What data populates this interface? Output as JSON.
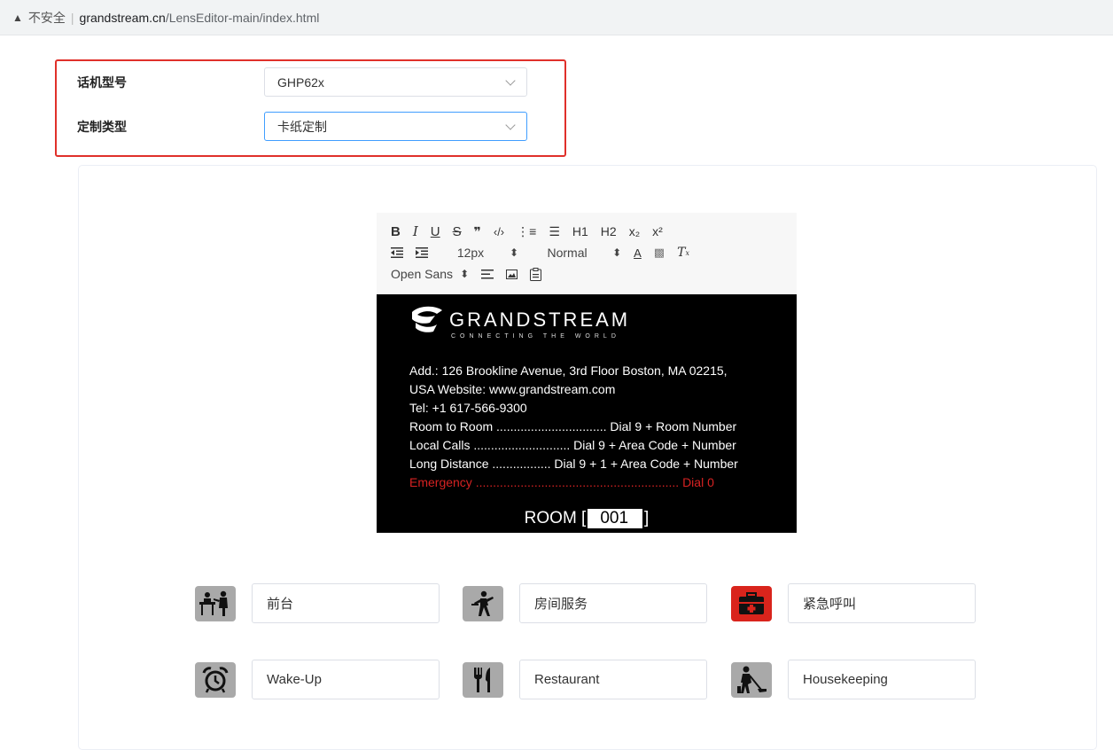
{
  "browser": {
    "warning_icon": "warning-triangle-icon",
    "insecure_label": "不安全",
    "separator": "|",
    "host": "grandstream.cn",
    "path": "/LensEditor-main/index.html"
  },
  "form": {
    "model_label": "话机型号",
    "model_value": "GHP62x",
    "type_label": "定制类型",
    "type_value": "卡纸定制"
  },
  "toolbar": {
    "row1": [
      "B",
      "I",
      "U",
      "S",
      "❞",
      "‹/›",
      "⋮≡",
      "☰",
      "H1",
      "H2",
      "x₂",
      "x²"
    ],
    "font_size": "12px",
    "heading": "Normal",
    "font_family": "Open Sans"
  },
  "label": {
    "logo_text": "GRANDSTREAM",
    "logo_sub": "CONNECTING THE WORLD",
    "address": "Add.: 126 Brookline Avenue, 3rd Floor Boston, MA 02215,",
    "website": "USA Website: www.grandstream.com",
    "tel": "Tel: +1 617-566-9300",
    "lines": [
      "Room to Room ................................ Dial 9 + Room Number",
      "Local Calls ............................ Dial 9 + Area Code + Number",
      "Long Distance ................. Dial 9 + 1 + Area Code + Number"
    ],
    "emergency": "Emergency ........................................................... Dial 0",
    "room_prefix": "ROOM [",
    "room_number": "001",
    "room_suffix": "]",
    "emergency_color": "#d62222"
  },
  "function_keys": [
    {
      "icon": "front-desk-icon",
      "label": "前台"
    },
    {
      "icon": "room-service-icon",
      "label": "房间服务"
    },
    {
      "icon": "emergency-kit-icon",
      "label": "紧急呼叫"
    },
    {
      "icon": "alarm-clock-icon",
      "label": "Wake-Up"
    },
    {
      "icon": "fork-knife-icon",
      "label": "Restaurant"
    },
    {
      "icon": "housekeeping-icon",
      "label": "Housekeeping"
    }
  ]
}
